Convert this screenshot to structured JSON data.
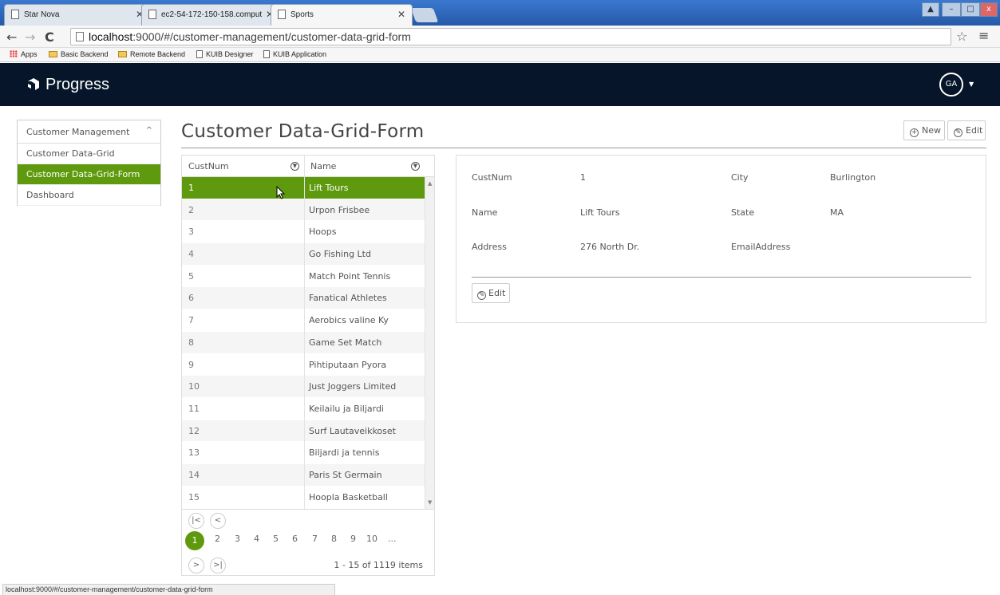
{
  "browser": {
    "tabs": [
      {
        "title": "Star Nova"
      },
      {
        "title": "ec2-54-172-150-158.comput"
      },
      {
        "title": "Sports"
      }
    ],
    "url_host": "localhost",
    "url_path": ":9000/#/customer-management/customer-data-grid-form",
    "bookmarks": [
      "Apps",
      "Basic Backend",
      "Remote Backend",
      "KUIB Designer",
      "KUIB Application"
    ],
    "status_url": "localhost:9000/#/customer-management/customer-data-grid-form"
  },
  "header": {
    "logo_text": "Progress",
    "avatar_initials": "GA"
  },
  "sidebar": {
    "section": "Customer Management",
    "items": [
      {
        "label": "Customer Data-Grid"
      },
      {
        "label": "Customer Data-Grid-Form"
      },
      {
        "label": "Dashboard"
      }
    ]
  },
  "page": {
    "title": "Customer Data-Grid-Form",
    "new_label": "New",
    "edit_label": "Edit"
  },
  "grid": {
    "columns": [
      "CustNum",
      "Name"
    ],
    "rows": [
      {
        "num": "1",
        "name": "Lift Tours"
      },
      {
        "num": "2",
        "name": "Urpon Frisbee"
      },
      {
        "num": "3",
        "name": "Hoops"
      },
      {
        "num": "4",
        "name": "Go Fishing Ltd"
      },
      {
        "num": "5",
        "name": "Match Point Tennis"
      },
      {
        "num": "6",
        "name": "Fanatical Athletes"
      },
      {
        "num": "7",
        "name": "Aerobics valine Ky"
      },
      {
        "num": "8",
        "name": "Game Set Match"
      },
      {
        "num": "9",
        "name": "Pihtiputaan Pyora"
      },
      {
        "num": "10",
        "name": "Just Joggers Limited"
      },
      {
        "num": "11",
        "name": "Keilailu ja Biljardi"
      },
      {
        "num": "12",
        "name": "Surf Lautaveikkoset"
      },
      {
        "num": "13",
        "name": "Biljardi ja tennis"
      },
      {
        "num": "14",
        "name": "Paris St Germain"
      },
      {
        "num": "15",
        "name": "Hoopla Basketball"
      }
    ],
    "pager": {
      "pages": [
        "1",
        "2",
        "3",
        "4",
        "5",
        "6",
        "7",
        "8",
        "9",
        "10",
        "..."
      ],
      "current": "1",
      "info": "1 - 15 of 1119 items"
    }
  },
  "detail": {
    "fields": {
      "custnum_label": "CustNum",
      "custnum_value": "1",
      "city_label": "City",
      "city_value": "Burlington",
      "name_label": "Name",
      "name_value": "Lift Tours",
      "state_label": "State",
      "state_value": "MA",
      "address_label": "Address",
      "address_value": "276 North Dr.",
      "email_label": "EmailAddress",
      "email_value": ""
    },
    "edit_label": "Edit"
  },
  "colors": {
    "accent_green": "#5f9a0e",
    "header_bg": "#061529"
  }
}
